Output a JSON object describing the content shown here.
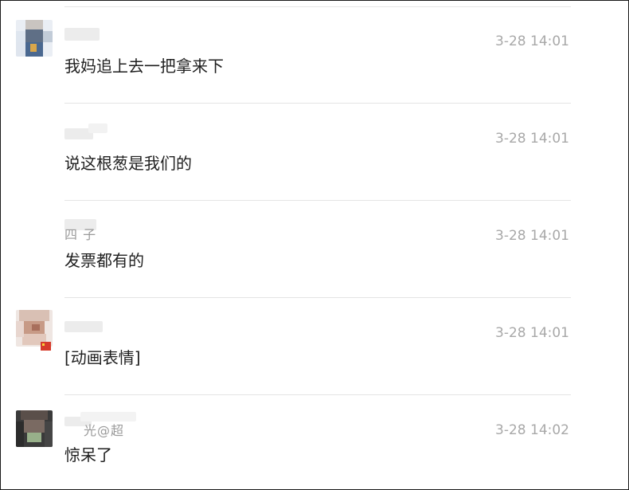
{
  "comments": [
    {
      "name_glyphs": "",
      "time": "3-28 14:01",
      "text": "我妈追上去一把拿来下"
    },
    {
      "name_glyphs": "",
      "time": "3-28 14:01",
      "text": "说这根葱是我们的"
    },
    {
      "name_glyphs": "四 子",
      "time": "3-28 14:01",
      "text": "发票都有的"
    },
    {
      "name_glyphs": "",
      "time": "3-28 14:01",
      "text": "[动画表情]"
    },
    {
      "name_glyphs": "光@超",
      "time": "3-28 14:02",
      "text": "惊呆了"
    }
  ],
  "colors": {
    "time": "#a8a8a8",
    "text": "#1f1f1f",
    "divider": "#e4e4e4",
    "border": "#1a1a1a"
  }
}
